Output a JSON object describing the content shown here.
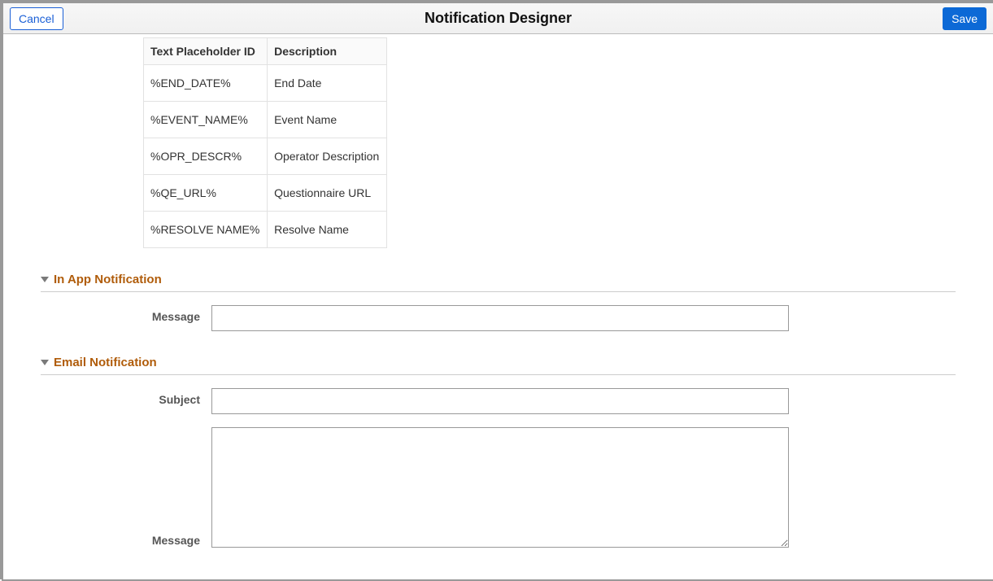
{
  "header": {
    "title": "Notification Designer",
    "cancel_label": "Cancel",
    "save_label": "Save"
  },
  "placeholder_table": {
    "columns": [
      "Text Placeholder ID",
      "Description"
    ],
    "rows": [
      {
        "id": "%END_DATE%",
        "desc": "End Date"
      },
      {
        "id": "%EVENT_NAME%",
        "desc": "Event Name"
      },
      {
        "id": "%OPR_DESCR%",
        "desc": "Operator Description"
      },
      {
        "id": "%QE_URL%",
        "desc": "Questionnaire URL"
      },
      {
        "id": "%RESOLVE NAME%",
        "desc": "Resolve Name"
      }
    ]
  },
  "sections": {
    "in_app": {
      "title": "In App Notification",
      "message_label": "Message",
      "message_value": ""
    },
    "email": {
      "title": "Email Notification",
      "subject_label": "Subject",
      "subject_value": "",
      "message_label": "Message",
      "message_value": ""
    }
  }
}
